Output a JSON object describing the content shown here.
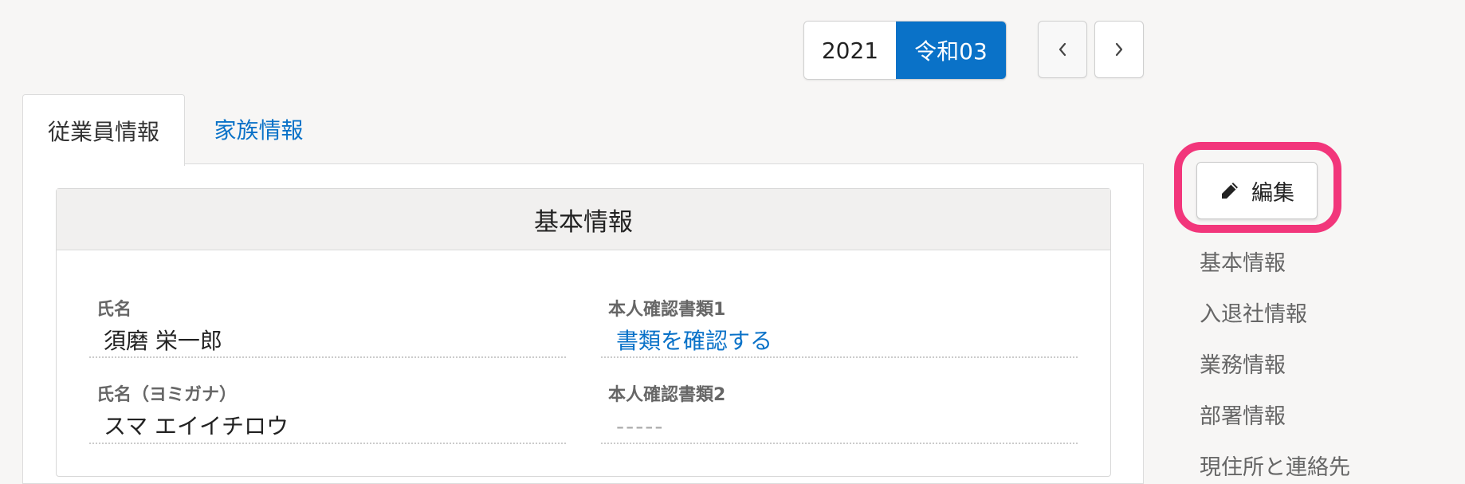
{
  "year_toggle": {
    "western": "2021",
    "japanese": "令和03"
  },
  "nav": {
    "prev_symbol": "<",
    "next_symbol": ">"
  },
  "tabs": [
    {
      "label": "従業員情報",
      "active": true
    },
    {
      "label": "家族情報",
      "active": false
    }
  ],
  "card": {
    "title": "基本情報",
    "fields": {
      "name_label": "氏名",
      "name_value": "須磨 栄一郎",
      "kana_label": "氏名（ヨミガナ）",
      "kana_value": "スマ エイイチロウ",
      "id_doc1_label": "本人確認書類1",
      "id_doc1_value": "書類を確認する",
      "id_doc2_label": "本人確認書類2",
      "id_doc2_value": "-----"
    }
  },
  "edit_button": {
    "label": "編集",
    "icon": "pencil-icon"
  },
  "side_nav": [
    "基本情報",
    "入退社情報",
    "業務情報",
    "部署情報",
    "現住所と連絡先"
  ],
  "colors": {
    "accent": "#0a72c8",
    "highlight": "#f2367b"
  }
}
